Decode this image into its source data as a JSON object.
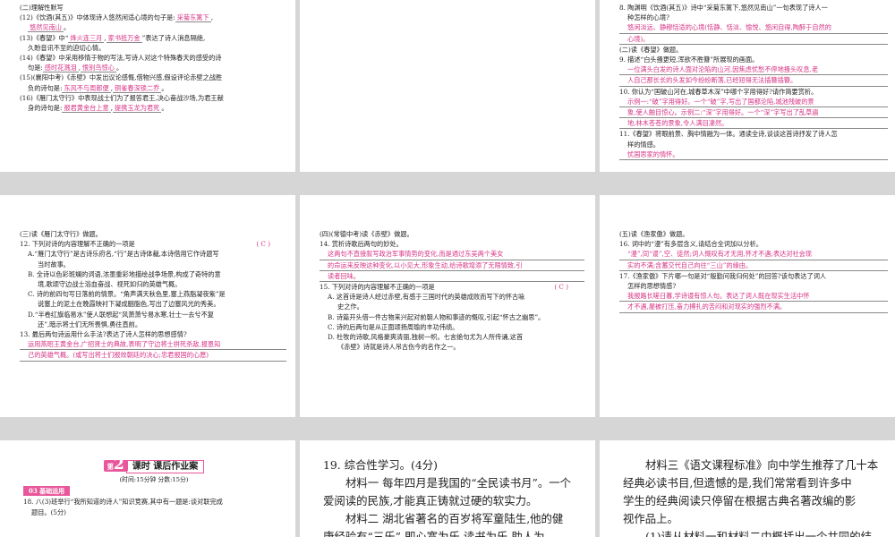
{
  "p1": {
    "sec": "(二)理解性默写",
    "q12a": "(12)《饮酒(其五)》中体现诗人悠然闲适心境的句子是:",
    "q12b": "采菊东篱下",
    "q12c": ",",
    "q12d": "悠然见南山",
    "q12e": "。",
    "q13a": "(13)《春望》中“",
    "q13b": "烽火连三月",
    "q13c": ",",
    "q13d": "家书抵万金",
    "q13e": "”表达了诗人消息隔绝,",
    "q13f": "久盼音讯不至的迫切心情。",
    "q14a": "(14)《春望》中采用移情于物的写法,写诗人对这个特殊春天的感受的诗",
    "q14b": "句是:",
    "q14c": "感时花溅泪",
    "q14d": ",",
    "q14e": "恨别鸟惊心",
    "q14f": "。",
    "q15a": "(15)(襄阳中考)《赤壁》中发出议论感慨,借物兴感,假设评论赤壁之战胜",
    "q15b": "负的诗句是:",
    "q15c": "东风不与周郎便",
    "q15d": ",",
    "q15e": "铜雀春深锁二乔",
    "q15f": "。",
    "q16a": "(16)《雁门太守行》中表现战士们为了报答君王,决心奋战沙场,为君王献",
    "q16b": "身的诗句是:",
    "q16c": "报君黄金台上意",
    "q16d": ",",
    "q16e": "提携玉龙为君死",
    "q16f": "。"
  },
  "p3": {
    "q8a": "8. 陶渊明《饮酒(其五)》诗中“采菊东篱下,悠然见南山”一句表现了诗人一",
    "q8b": "种怎样的心境?",
    "q8ans1": "悠闲淡远、静穆恬适的心境(恬静、恬淡、愉悦、悠闲自得,陶醉于自然的",
    "q8ans2": "心境)。",
    "sec2": "(二)读《春望》做题。",
    "q9": "9. 描述“白头搔更短,浑欲不胜簪”所展现的画面。",
    "q9ans1": "一位满头白发的诗人面对沦陷的山河,因焦虑忧愁不停地搔头叹息,老",
    "q9ans2": "人自己那长长的头发如今纷纷断落,已经短得无法插簪插簪。",
    "q10a": "10. 你认为“国破山河在,城春草木深”中哪个字用得好?请作简要赏析。",
    "q10ans1": "示例一:“破”字用得好。一个“破”字,写出了国都沦陷,城池残破的景",
    "q10ans2": "象,使人触目惊心。示例二:“深”字用得好。一个“深”字写出了乱草遍",
    "q10ans3": "地,林木苍苍的景象,令人满目凄然。",
    "q11a": "11.《春望》将眼前景、胸中情融为一体。通读全诗,谈谈这首诗抒发了诗人怎",
    "q11b": "样的情感。",
    "q11ans": "忧国思家的情怀。"
  },
  "p4": {
    "sec": "(三)读《雁门太守行》做题。",
    "q12": "12. 下列对诗的内容理解不正确的一项是",
    "q12ansL": "( ",
    "q12ans": "C",
    "q12ansR": " )",
    "A1": "A.“雁门太守行”是古诗乐府名,“行”是古诗体裁,本诗借用它作诗题写",
    "A2": "当时故事。",
    "B1": "B. 全诗以色彩斑斓的词语,浓墨重彩地描绘战争场景,构成了奇特的意",
    "B2": "境,歌颂守边战士浴血奋战、视死如归的英雄气概。",
    "C1": "C. 诗的前四句写日落前的情景。“角声满天秋色里,塞上燕脂凝夜紫”是",
    "C2": "说塞上的泥土在晚霞映衬下凝成胭脂色,写出了边塞风光的秀美。",
    "D1": "D.“半卷红旗临易水”使人联想起“风萧萧兮易水寒,壮士一去兮不复",
    "D2": "还”,暗示将士们无所畏惧,勇往直前。",
    "q13": "13. 最后两句诗运用什么手法?表达了诗人怎样的思想感情?",
    "q13ans1": "运用燕昭王黄金台,广招贤士的典故,表明了守边将士拼死杀敌,报恩知",
    "q13ans2": "己的英雄气概。(或写出将士们报效朝廷的决心;忠君报国的心愿)"
  },
  "p5": {
    "sec": "(四)(常德中考)读《赤壁》做题。",
    "q14": "14. 赏析诗歌后两句的妙处。",
    "q14ans1": "这两句不直接叙写政治军事情势的变化,而是通过东吴两个美女",
    "q14ans2": "的命运来反映这种变化,以小见大,形象生动,给诗歌增添了无限情致,引",
    "q14ans3": "读者回味。",
    "q15": "15. 下列对诗的内容理解不正确的一项是",
    "q15ansL": "( ",
    "q15ans": "C",
    "q15ansR": " )",
    "A1": "A. 这首诗是诗人经过赤壁,有感于三国时代的英雄成败而写下的怀古咏",
    "A2": "史之作。",
    "B": "B. 诗篇开头借一件古物来兴起对前朝人物和事迹的慨叹,引起“怀古之幽思”。",
    "C": "C. 诗的后两句是从正面颂扬周瑜的丰功伟绩。",
    "D1": "D. 杜牧的诗歌,风格豪爽清丽,独树一帜。七言绝句尤为人所传诵,这首",
    "D2": "《赤壁》诗就是诗人吊古伤今的名作之一。"
  },
  "p6": {
    "sec": "(五)读《渔家傲》做题。",
    "q16": "16. 词中的“漫”有多层含义,请结合全词加以分析。",
    "q16ans1": "“漫”,同“谩”,空、徒然;词人慨叹有才无用,怀才不遇;表达对社会现",
    "q16ans2": "实的不满;含蓄交代自己向往“三山”的缘由。",
    "q17a": "17.《渔家傲》下片哪一句是对“殷勤问我归何处”的回答?该句表达了词人",
    "q17b": "怎样的思想情感?",
    "q17ans1": "我报路长嗟日暮,学诗谩有惊人句。表达了词人既在现实生活中怀",
    "q17ans2": "才不遇,屡被打压,奋力搏扎的苦闷和对现实的强烈不满。"
  },
  "p7": {
    "num": "2",
    "tt": "课时  课后作业案",
    "meta": "(时间:15分钟  分数:15分)",
    "tag": "03 基础运用",
    "q18a": "18. 八(3)班举行“我所知道的诗人”知识竞赛,其中有一题是:谈对联完成",
    "q18b": "题目。(5分)"
  },
  "p8": {
    "q19": "19. 综合性学习。(4分)",
    "m1a": "材料一",
    "m1b": " 每年四月是我国的“全民读书月”。一个",
    "m1c": "爱阅读的民族,才能真正铸就过硬的软实力。",
    "m2a": "材料二",
    "m2b": " 湖北省著名的百岁将军童陆生,他的健",
    "m2c": "康经验有“三乐”,即心宽为乐,读书为乐,助人为"
  },
  "p9": {
    "m3a": "材料三",
    "m3b": "《语文课程标准》向中学生推荐了几十本",
    "m3c": "经典必读书目,但遗憾的是,我们常常看到许多中",
    "m3d": "学生的经典阅读只停留在根据古典名著改编的影",
    "m3e": "视作品上。",
    "q1": "(1)请从材料一和材料二中概括出一个共同的结"
  }
}
